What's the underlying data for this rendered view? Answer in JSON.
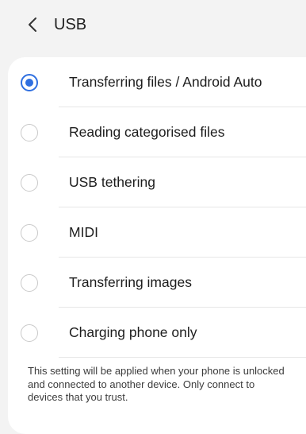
{
  "header": {
    "title": "USB",
    "back_icon": "chevron-left-icon"
  },
  "options": [
    {
      "label": "Transferring files / Android Auto",
      "selected": true
    },
    {
      "label": "Reading categorised files",
      "selected": false
    },
    {
      "label": "USB tethering",
      "selected": false
    },
    {
      "label": "MIDI",
      "selected": false
    },
    {
      "label": "Transferring images",
      "selected": false
    },
    {
      "label": "Charging phone only",
      "selected": false
    }
  ],
  "note": "This setting will be applied when your phone is unlocked and connected to another device. Only connect to devices that you trust.",
  "colors": {
    "accent": "#2f6fe0",
    "background": "#f3f3f3",
    "card": "#ffffff"
  }
}
